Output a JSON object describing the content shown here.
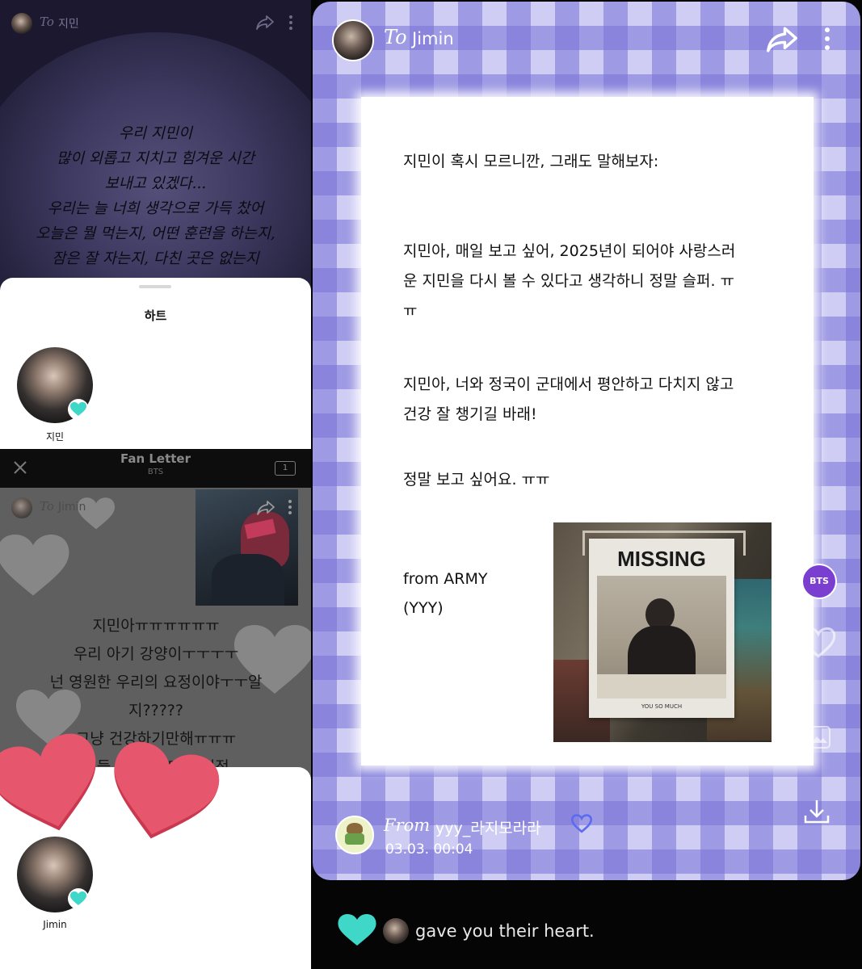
{
  "panel_a": {
    "to_prefix": "To",
    "recipient": "지민",
    "letter_lines": [
      "우리 지민이",
      "많이 외롭고 지치고 힘겨운 시간",
      "보내고 있겠다...",
      "우리는 늘 너희 생각으로 가득 찼어",
      "오늘은 뭘 먹는지, 어떤 훈련을 하는지,",
      "잠은 잘 자는지, 다친 곳은 없는지"
    ],
    "sheet_title": "하트",
    "user_name": "지민",
    "icons": [
      "share-icon",
      "more-icon",
      "heart-icon"
    ]
  },
  "panel_b": {
    "header_title": "Fan Letter",
    "header_subtitle": "BTS",
    "ticket_count": "1",
    "to_prefix": "To",
    "recipient": "Jimin",
    "letter_lines": [
      "지민아ㅠㅠㅠㅠㅠㅠ",
      "우리 아기 강양이ㅜㅜㅜㅜ",
      "넌 영원한 우리의 요정이야ㅜㅜ알",
      "지?????",
      "그냥 건강하기만해ㅠㅠㅠ",
      "힘들 로 가서 매일 걱정"
    ],
    "user_name": "Jimin",
    "heart_color": "#e6566d",
    "icons": [
      "close-icon",
      "ticket-icon",
      "share-icon",
      "more-icon",
      "heart-icon"
    ]
  },
  "panel_c": {
    "to_prefix": "To",
    "recipient": "Jimin",
    "paragraphs": [
      "지민이 혹시 모르니깐, 그래도 말해보자:",
      "지민아, 매일 보고 싶어, 2025년이 되어야 사랑스러운 지민을 다시 볼 수 있다고 생각하니 정말 슬퍼. ㅠㅠ",
      "지민아, 너와 정국이 군대에서 평안하고 다치지 않고 건강 잘 챙기길 바래!",
      "정말 보고 싶어요. ㅠㅠ"
    ],
    "signature_lines": [
      "from ARMY",
      "(YYY)"
    ],
    "photo_sign_title": "MISSING",
    "photo_sign_caption": "YOU SO MUCH",
    "badge_label": "BTS",
    "from_prefix": "From",
    "from_user": "yyy_라지모라라",
    "timestamp": "03.03. 00:04",
    "notification": "gave you their heart.",
    "accent_color": "#7b74d6",
    "badge_color": "#7a3fd0",
    "heart_color": "#3fd7c7",
    "icons": [
      "share-icon",
      "more-icon",
      "download-icon",
      "heart-icon",
      "image-icon",
      "verified-icon"
    ]
  }
}
